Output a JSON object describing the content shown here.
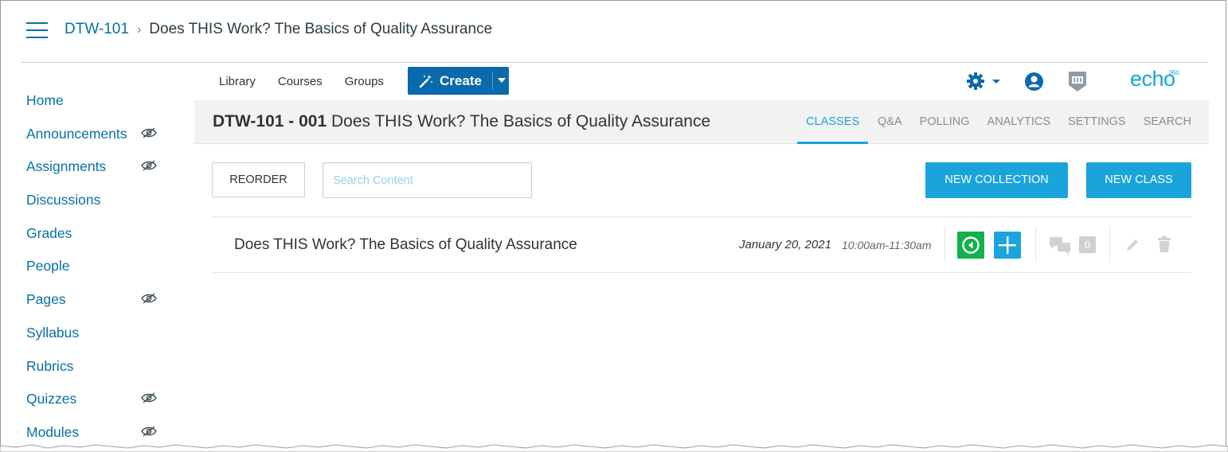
{
  "breadcrumb": {
    "course_link": "DTW-101",
    "separator": "›",
    "current": "Does THIS Work? The Basics of Quality Assurance"
  },
  "course_nav": {
    "items": [
      {
        "label": "Home",
        "hidden": false
      },
      {
        "label": "Announcements",
        "hidden": true
      },
      {
        "label": "Assignments",
        "hidden": true
      },
      {
        "label": "Discussions",
        "hidden": false
      },
      {
        "label": "Grades",
        "hidden": false
      },
      {
        "label": "People",
        "hidden": false
      },
      {
        "label": "Pages",
        "hidden": true
      },
      {
        "label": "Syllabus",
        "hidden": false
      },
      {
        "label": "Rubrics",
        "hidden": false
      },
      {
        "label": "Quizzes",
        "hidden": true
      },
      {
        "label": "Modules",
        "hidden": true
      }
    ]
  },
  "echo_nav": {
    "library": "Library",
    "courses": "Courses",
    "groups": "Groups",
    "create": "Create"
  },
  "brand": {
    "logo_text": "echo",
    "logo_superscript": "360"
  },
  "section": {
    "code": "DTW-101 - 001",
    "title": "Does THIS Work? The Basics of Quality Assurance"
  },
  "tabs": [
    {
      "label": "CLASSES",
      "active": true
    },
    {
      "label": "Q&A",
      "active": false
    },
    {
      "label": "POLLING",
      "active": false
    },
    {
      "label": "ANALYTICS",
      "active": false
    },
    {
      "label": "SETTINGS",
      "active": false
    },
    {
      "label": "SEARCH",
      "active": false
    }
  ],
  "controls": {
    "reorder": "REORDER",
    "search_placeholder": "Search Content",
    "new_collection": "NEW COLLECTION",
    "new_class": "NEW CLASS"
  },
  "class_row": {
    "title": "Does THIS Work? The Basics of Quality Assurance",
    "date": "January 20, 2021",
    "time": "10:00am-11:30am",
    "discussion_count": "0"
  },
  "colors": {
    "canvas_link": "#0770a3",
    "echo_blue": "#1ba4dc",
    "create_blue": "#0a6aab",
    "live_green": "#13b14b"
  }
}
